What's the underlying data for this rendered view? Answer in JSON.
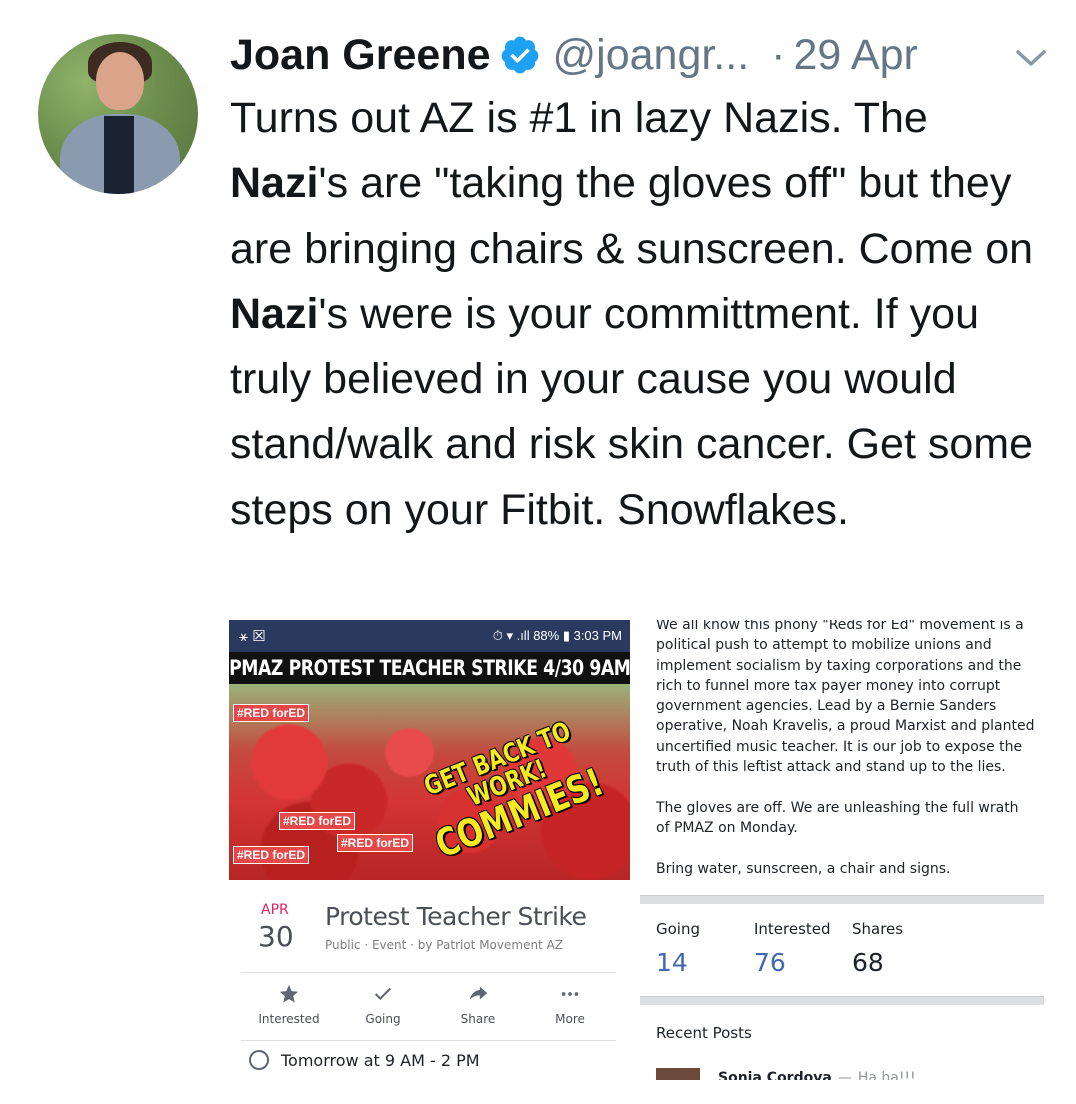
{
  "tweet": {
    "author_name": "Joan Greene",
    "handle": "@joangr...",
    "separator": "·",
    "date": "29 Apr",
    "text_segments": [
      {
        "text": "Turns out AZ is #1 in lazy Nazis. The ",
        "bold": false
      },
      {
        "text": "Nazi",
        "bold": true
      },
      {
        "text": "'s are \"taking the gloves off\" but they are bringing chairs & sunscreen. Come on ",
        "bold": false
      },
      {
        "text": "Nazi",
        "bold": true
      },
      {
        "text": "'s were is your committment. If you truly believed in your cause you would stand/walk and risk skin cancer. Get some steps on your Fitbit. Snowflakes.",
        "bold": false
      }
    ]
  },
  "event_screenshot": {
    "status_bar": {
      "left": "⚹ ☒",
      "right": "⏱ ▾ .ıll 88% ▮ 3:03 PM"
    },
    "banner": "PMAZ PROTEST TEACHER STRIKE 4/30 9AM",
    "photo_overlay": {
      "line1": "GET BACK TO WORK!",
      "line2": "COMMIES!"
    },
    "photo_signs": [
      "#RED forED",
      "#RED forED",
      "#RED forED",
      "#RED forED"
    ],
    "month": "APR",
    "day": "30",
    "title": "Protest Teacher Strike",
    "subtitle": "Public · Event · by Patriot Movement AZ",
    "actions": [
      {
        "label": "Interested",
        "icon": "star-icon"
      },
      {
        "label": "Going",
        "icon": "check-icon"
      },
      {
        "label": "Share",
        "icon": "share-arrow-icon"
      },
      {
        "label": "More",
        "icon": "more-dots-icon"
      }
    ],
    "time": "Tomorrow at 9 AM - 2 PM"
  },
  "post": {
    "paragraphs": [
      "We all know this phony \"Reds for Ed\" movement is a political push to attempt to mobilize unions and implement socialism by taxing corporations and the rich to funnel more tax payer money into corrupt government agencies. Lead by a Bernie Sanders operative, Noah Kravelis, a proud Marxist and planted uncertified music teacher. It is our job to expose the truth of this leftist attack and stand up to the lies.",
      "The gloves are off. We are unleashing the full wrath of PMAZ on Monday.",
      "Bring water, sunscreen, a chair and signs."
    ],
    "stats": [
      {
        "label": "Going",
        "value": "14",
        "color": "#4267b2"
      },
      {
        "label": "Interested",
        "value": "76",
        "color": "#4267b2"
      },
      {
        "label": "Shares",
        "value": "68",
        "color": "#1d2129"
      }
    ],
    "recent_posts_label": "Recent Posts",
    "recent_item": {
      "name": "Sonia Cordova",
      "dash": "—",
      "comment": "Ha ha!!!"
    }
  },
  "colors": {
    "verified_blue": "#1da1f2",
    "muted": "#657786",
    "facebook_blue": "#4267b2",
    "statusbar_navy": "#2a3a5e"
  }
}
